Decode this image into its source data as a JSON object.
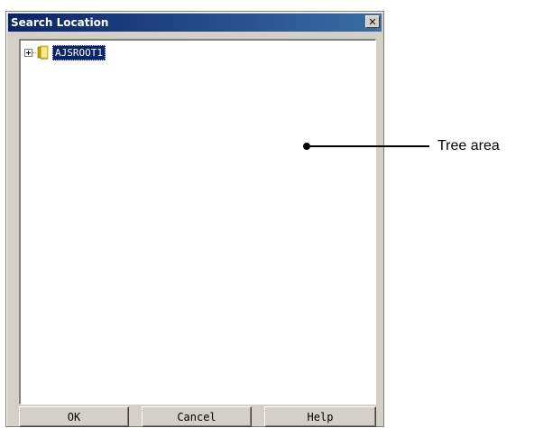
{
  "window": {
    "title": "Search Location",
    "close_glyph": "✕"
  },
  "tree": {
    "nodes": [
      {
        "label": "AJSROOT1",
        "expanded": false,
        "selected": true,
        "icon": "folder-icon"
      }
    ]
  },
  "buttons": {
    "ok_label": "OK",
    "cancel_label": "Cancel",
    "help_label": "Help"
  },
  "annotation": {
    "label": "Tree area"
  },
  "colors": {
    "titlebar_start": "#0a246a",
    "titlebar_end": "#3a6ea5",
    "selection": "#0a246a",
    "dialog_bg": "#d4d0c8"
  }
}
